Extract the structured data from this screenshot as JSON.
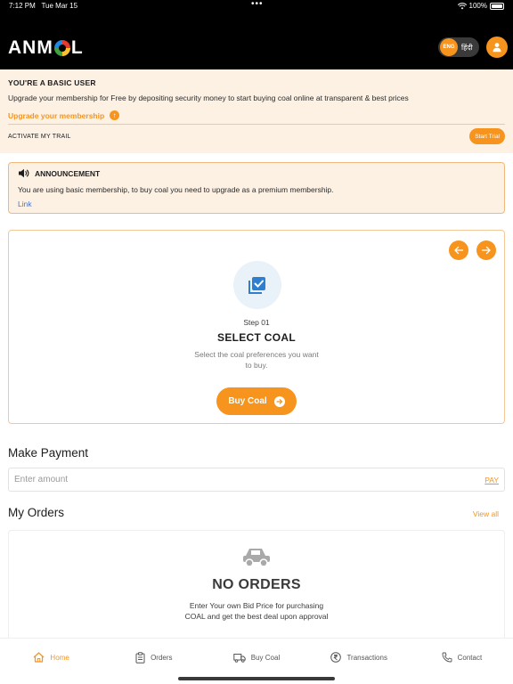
{
  "status_bar": {
    "time": "7:12 PM",
    "date": "Tue Mar 15",
    "dots": "•••",
    "battery": "100%"
  },
  "header": {
    "logo_left": "ANM",
    "logo_right": "L",
    "lang_active": "ENG",
    "lang_other": "हिंदी",
    "profile_icon": "user-icon"
  },
  "basic_banner": {
    "title": "YOU'RE A BASIC USER",
    "description": "Upgrade your membership for Free by depositing security money to start buying coal online at transparent & best prices",
    "upgrade_label": "Upgrade your membership",
    "activate_label": "ACTIVATE MY TRAIL",
    "start_trial_label": "Start Trial"
  },
  "announcement": {
    "title": "ANNOUNCEMENT",
    "text": "You are using basic membership, to buy coal you need to upgrade as a premium membership.",
    "link_label": "Link"
  },
  "step_card": {
    "step_number": "Step 01",
    "title": "SELECT COAL",
    "description": "Select the coal preferences you want to buy.",
    "button_label": "Buy Coal"
  },
  "payment": {
    "title": "Make Payment",
    "placeholder": "Enter amount",
    "pay_label": "PAY"
  },
  "orders": {
    "title": "My Orders",
    "view_all": "View all",
    "empty_title": "NO ORDERS",
    "empty_desc": "Enter Your own Bid Price for purchasing COAL and get the best deal upon approval"
  },
  "tabbar": {
    "items": [
      {
        "label": "Home",
        "icon": "home-icon",
        "active": true
      },
      {
        "label": "Orders",
        "icon": "clipboard-icon",
        "active": false
      },
      {
        "label": "Buy Coal",
        "icon": "truck-icon",
        "active": false
      },
      {
        "label": "Transactions",
        "icon": "rupee-icon",
        "active": false
      },
      {
        "label": "Contact",
        "icon": "phone-icon",
        "active": false
      }
    ]
  },
  "colors": {
    "accent": "#f7941d",
    "banner_bg": "#fdf1e4",
    "header_bg": "#000000",
    "link": "#4a73c7"
  }
}
